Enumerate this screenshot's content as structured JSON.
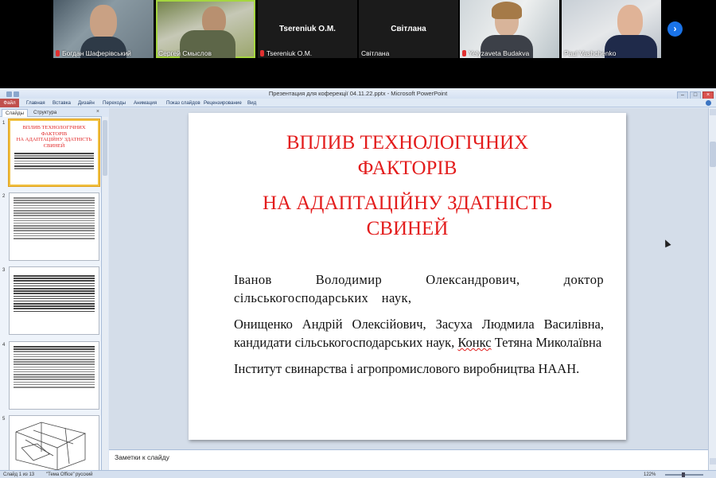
{
  "video": {
    "participants": [
      {
        "name": "Богдан Шаферівський",
        "muted": true
      },
      {
        "name": "Сергей Смыслов",
        "muted": false,
        "active": true
      },
      {
        "name": "Tsereniuk O.M.",
        "muted": true,
        "video": false,
        "label": "Tsereniuk O.M."
      },
      {
        "name": "Світлана",
        "muted": false,
        "video": false,
        "label": "Світлана"
      },
      {
        "name": "Yelyzaveta Budakva",
        "muted": true
      },
      {
        "name": "Paul Vashchenko",
        "muted": false
      }
    ],
    "next_icon": "chevron-right-icon",
    "next_glyph": "›"
  },
  "window": {
    "title": "Презентация для коферекції 04.11.22.pptx  -  Microsoft PowerPoint",
    "minimize": "–",
    "maximize": "□",
    "close": "×"
  },
  "ribbon": {
    "tabs": [
      "Файл",
      "Главная",
      "Вставка",
      "Дизайн",
      "Переходы",
      "Анимация",
      "Показ слайдов",
      "Рецензирование",
      "Вид"
    ]
  },
  "panel": {
    "tabs": [
      "Слайды",
      "Структура"
    ],
    "close": "×",
    "slide_numbers": [
      "1",
      "2",
      "3",
      "4",
      "5"
    ],
    "thumb1": {
      "title": "ВПЛИВ ТЕХНОЛОГІЧНИХ ФАКТОРІВ\nНА АДАПТАЦІЙНУ ЗДАТНІСТЬ СВИНЕЙ"
    }
  },
  "slide": {
    "title_line1": "ВПЛИВ ТЕХНОЛОГІЧНИХ",
    "title_line2": "ФАКТОРІВ",
    "title_line3": "НА АДАПТАЦІЙНУ ЗДАТНІСТЬ",
    "title_line4": "СВИНЕЙ",
    "author1": "Іванов Володимир Олександрович, доктор сільськогосподарських наук,",
    "author2_a": "Онищенко Андрій Олексійович, Засуха Людмила Василівна, кандидати сільськогосподарських наук, ",
    "author2_underlined": "Конкс",
    "author2_b": " Тетяна Миколаївна",
    "institution": "Інститут свинарства і агропромислового виробництва НААН."
  },
  "notes": {
    "placeholder": "Заметки к слайду"
  },
  "status": {
    "slide_info": "Слайд 1 из 13",
    "theme": "\"Тема Office\"",
    "language": "русский",
    "zoom": "122%"
  }
}
